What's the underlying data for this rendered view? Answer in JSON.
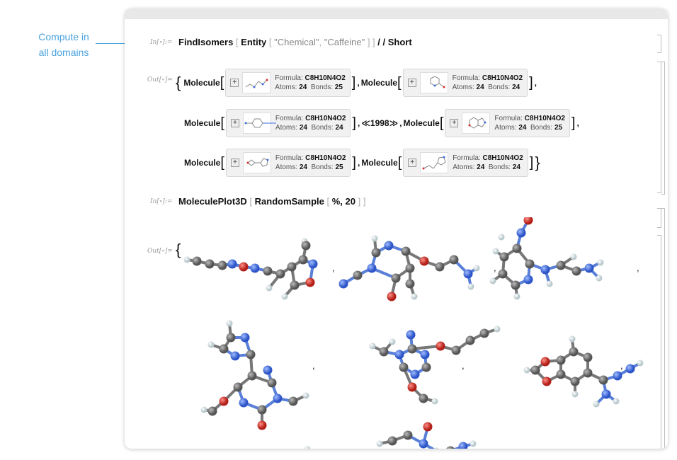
{
  "annotation": {
    "line1": "Compute in",
    "line2": "all domains"
  },
  "cells": {
    "in1": {
      "label": "In[∘]:=",
      "func": "FindIsomers",
      "entity": "Entity",
      "arg1": "\"Chemical\"",
      "arg2": "\"Caffeine\"",
      "postfix": "/ /",
      "short": "Short"
    },
    "out1": {
      "label": "Out[∘]=",
      "head": "Molecule",
      "formula_label": "Formula:",
      "formula": "C8H10N4O2",
      "atoms_label": "Atoms:",
      "bonds_label": "Bonds:",
      "elision": "≪1998≫",
      "items": [
        {
          "atoms": "24",
          "bonds": "25"
        },
        {
          "atoms": "24",
          "bonds": "24"
        },
        {
          "atoms": "24",
          "bonds": "24"
        },
        {
          "atoms": "24",
          "bonds": "25"
        },
        {
          "atoms": "24",
          "bonds": "25"
        },
        {
          "atoms": "24",
          "bonds": "24"
        }
      ]
    },
    "in2": {
      "label": "In[∘]:=",
      "func": "MoleculePlot3D",
      "inner": "RandomSample",
      "arg1": "%",
      "arg2": "20"
    },
    "out2": {
      "label": "Out[∘]="
    }
  },
  "colors": {
    "accent": "#4aa3df",
    "carbon": "#6a6a6a",
    "nitrogen": "#3e6ee0",
    "oxygen": "#d8312b",
    "hydrogen": "#e6eef0"
  }
}
